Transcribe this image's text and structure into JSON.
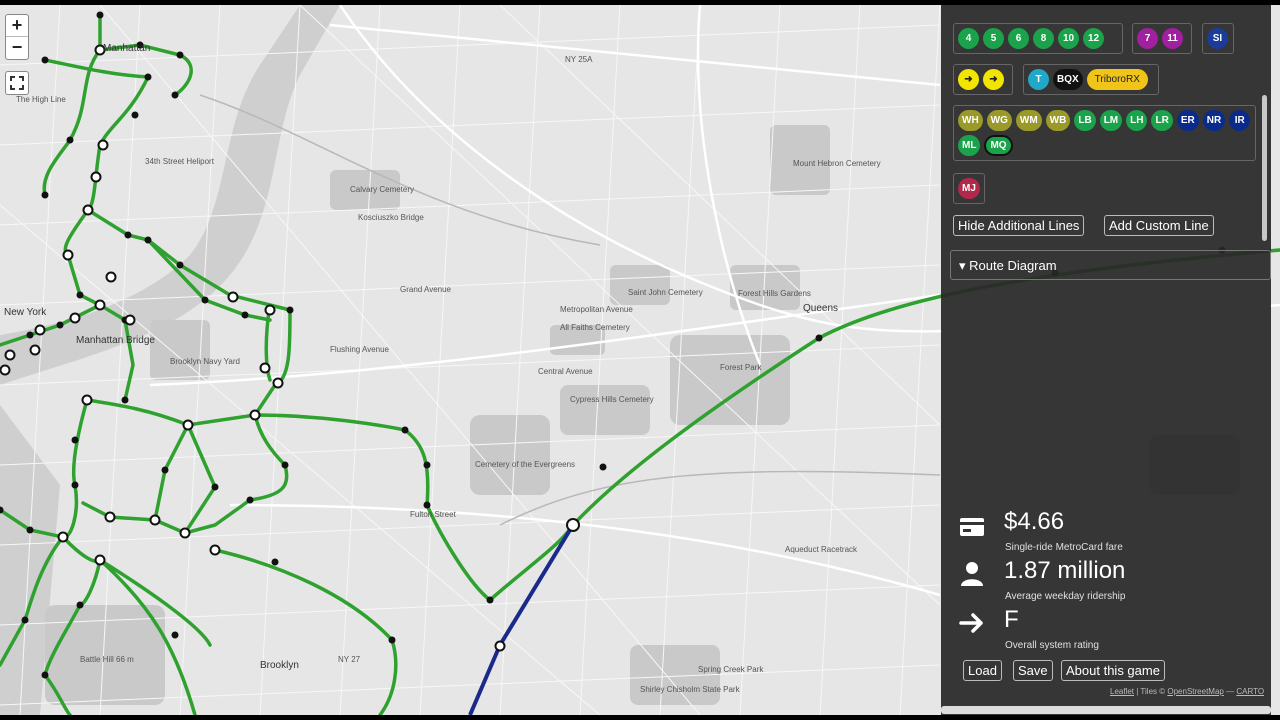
{
  "map": {
    "zoom_in": "+",
    "zoom_out": "−",
    "labels": {
      "high_line": "The High Line",
      "manhattan": "Manhattan",
      "new_york": "New York",
      "manhattan_bridge": "Manhattan Bridge",
      "brooklyn_navy_yard": "Brooklyn Navy Yard",
      "battle_hill": "Battle Hill 66 m",
      "brooklyn": "Brooklyn",
      "queens": "Queens",
      "kosciuszko": "Kosciuszko Bridge",
      "calvary": "Calvary Cemetery",
      "saint_john": "Saint John Cemetery",
      "all_faiths": "All Faiths Cemetery",
      "cypress_hills": "Cypress Hills Cemetery",
      "evergreens": "Cemetery of the Evergreens",
      "forest_hills": "Forest Hills Gardens",
      "forest_park": "Forest Park",
      "mount_hebron": "Mount Hebron Cemetery",
      "aqueduct": "Aqueduct Racetrack",
      "spring_creek": "Spring Creek Park",
      "shirley": "Shirley Chisholm State Park",
      "metropolitan_ave": "Metropolitan Avenue",
      "central_ave": "Central Avenue",
      "flushing_ave": "Flushing Avenue",
      "grand_ave": "Grand Avenue",
      "fulton": "Fulton Street",
      "ny25a": "NY 25A",
      "ny27": "NY 27",
      "heliport": "34th Street Heliport"
    }
  },
  "panel": {
    "line_groups": [
      [
        {
          "label": "4",
          "color": "#1aa34a"
        },
        {
          "label": "5",
          "color": "#1aa34a"
        },
        {
          "label": "6",
          "color": "#1aa34a"
        },
        {
          "label": "8",
          "color": "#1aa34a"
        },
        {
          "label": "10",
          "color": "#1aa34a"
        },
        {
          "label": "12",
          "color": "#1aa34a"
        }
      ],
      [
        {
          "label": "7",
          "color": "#a020a0"
        },
        {
          "label": "11",
          "color": "#a020a0"
        }
      ],
      [
        {
          "label": "SI",
          "color": "#1a3c9c"
        }
      ],
      [
        {
          "label": "➜",
          "color": "#f2e600",
          "text_color": "#222"
        },
        {
          "label": "➜",
          "color": "#f2e600",
          "text_color": "#222"
        }
      ],
      [
        {
          "label": "T",
          "color": "#21a8c8"
        },
        {
          "label": "BQX",
          "color": "#111111"
        },
        {
          "label": "TriboroRX",
          "color": "#f0c419",
          "text_color": "#222"
        }
      ]
    ],
    "lirr_group": [
      {
        "label": "WH",
        "color": "#9a9a2a"
      },
      {
        "label": "WG",
        "color": "#9a9a2a"
      },
      {
        "label": "WM",
        "color": "#9a9a2a"
      },
      {
        "label": "WB",
        "color": "#9a9a2a"
      },
      {
        "label": "LB",
        "color": "#1aa34a"
      },
      {
        "label": "LM",
        "color": "#1aa34a"
      },
      {
        "label": "LH",
        "color": "#1aa34a"
      },
      {
        "label": "LR",
        "color": "#1aa34a"
      },
      {
        "label": "ER",
        "color": "#0a2a8c"
      },
      {
        "label": "NR",
        "color": "#0a2a8c"
      },
      {
        "label": "IR",
        "color": "#0a2a8c"
      },
      {
        "label": "ML",
        "color": "#1aa34a"
      },
      {
        "label": "MQ",
        "color": "#1aa34a"
      }
    ],
    "mj_group": [
      {
        "label": "MJ",
        "color": "#b0284a"
      }
    ],
    "hide_lines": "Hide Additional Lines",
    "add_custom": "Add Custom Line",
    "route_diagram": "▾ Route Diagram",
    "fare_value": "$4.66",
    "fare_label": "Single-ride MetroCard fare",
    "ridership_value": "1.87 million",
    "ridership_label": "Average weekday ridership",
    "rating_value": "F",
    "rating_label": "Overall system rating",
    "load": "Load",
    "save": "Save",
    "about": "About this game",
    "attribution": {
      "leaflet": "Leaflet",
      "sep1": "| Tiles ©",
      "osm": "OpenStreetMap",
      "sep2": "—",
      "carto": "CARTO"
    }
  },
  "icons": {
    "card": "card-icon",
    "person": "person-icon",
    "arrow": "arrow-right-icon",
    "fullscreen": "fullscreen-icon"
  }
}
